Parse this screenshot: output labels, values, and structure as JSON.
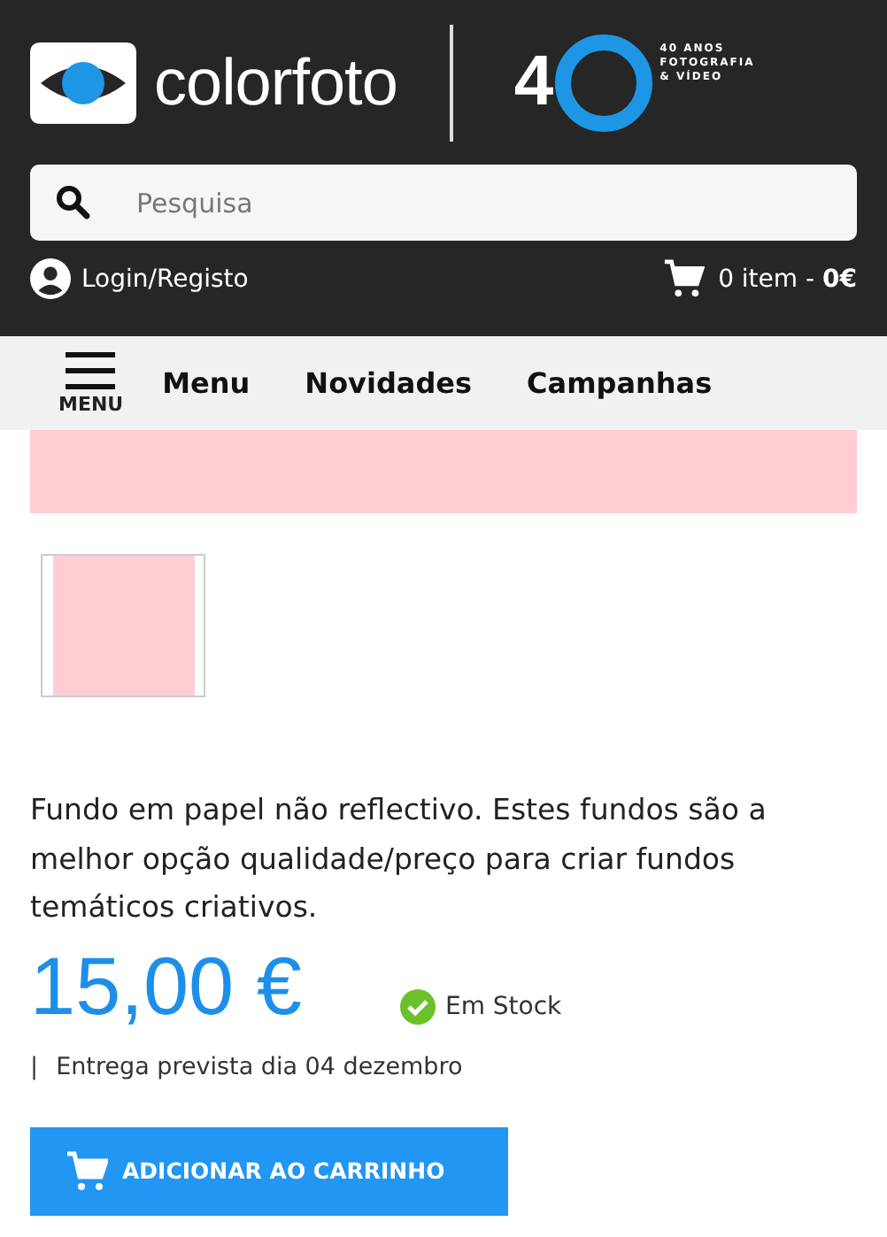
{
  "header": {
    "logo_text": "colorfoto",
    "anniversary_digit": "4",
    "anniversary_caption": [
      "40 ANOS",
      "FOTOGRAFIA",
      "& VÍDEO"
    ],
    "search": {
      "placeholder": "Pesquisa"
    },
    "login": "Login/Registo",
    "cart": "0 item - **0€**"
  },
  "nav": {
    "menu_icon_label": "MENU",
    "items": [
      "Menu",
      "Novidades",
      "Campanhas"
    ]
  },
  "product": {
    "description": "Fundo em papel não reflectivo. Estes fundos são a melhor opção qualidade/preço para criar fundos temáticos criativos.",
    "price": "15,00 €",
    "in_stock": true,
    "stock_label": "Em Stock",
    "delivery_separator": "|",
    "delivery": "Entrega prevista dia 04 dezembro",
    "add_button": "ADICIONAR AO CARRINHO"
  }
}
